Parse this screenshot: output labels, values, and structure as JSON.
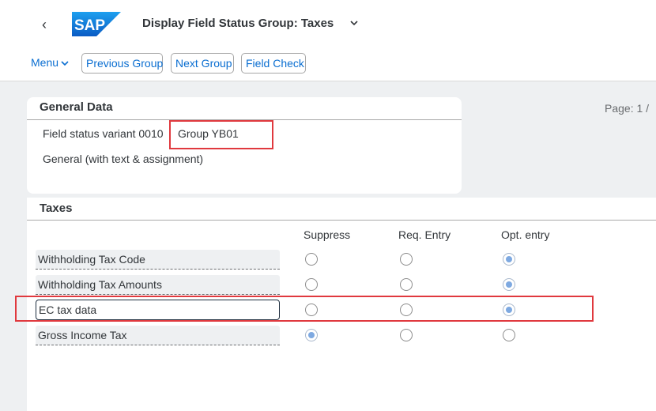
{
  "header": {
    "title": "Display Field Status Group: Taxes",
    "logo_text": "SAP"
  },
  "toolbar": {
    "menu_label": "Menu",
    "buttons": [
      {
        "label": "Previous Group"
      },
      {
        "label": "Next Group"
      },
      {
        "label": "Field Check"
      }
    ]
  },
  "general_data": {
    "title": "General Data",
    "field_status_variant": "Field status variant 0010",
    "group": "Group YB01",
    "description": "General (with text & assignment)"
  },
  "pager": {
    "label": "Page: 1  /"
  },
  "taxes": {
    "title": "Taxes",
    "columns": [
      "Suppress",
      "Req. Entry",
      "Opt. entry"
    ],
    "rows": [
      {
        "label": "Withholding Tax Code",
        "selected": "Opt. entry"
      },
      {
        "label": "Withholding Tax Amounts",
        "selected": "Opt. entry"
      },
      {
        "label": "EC tax data",
        "selected": "Opt. entry"
      },
      {
        "label": "Gross Income Tax",
        "selected": "Suppress"
      }
    ]
  },
  "colors": {
    "accent": "#0a6ed1",
    "highlight": "#e0393e",
    "logo_blue": "#0a6ed1"
  }
}
